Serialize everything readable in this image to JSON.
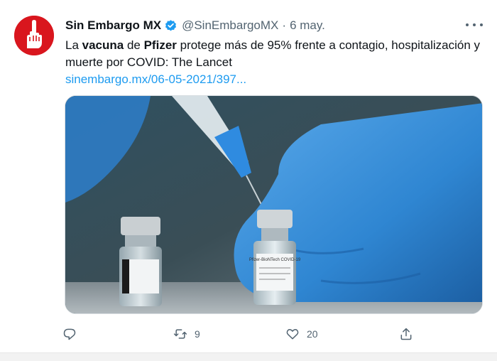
{
  "tweet": {
    "author_name": "Sin Embargo MX",
    "handle": "@SinEmbargoMX",
    "separator": "·",
    "time": "6 may.",
    "text_parts": {
      "p1": "La ",
      "bold1": "vacuna",
      "p2": " de ",
      "bold2": "Pfizer",
      "p3": " protege más de 95% frente a contagio, hospitalización y muerte por COVID: The Lancet"
    },
    "link": "sinembargo.mx/06-05-2021/397..."
  },
  "vial_label": "Pfizer-BioNTech COVID-19",
  "actions": {
    "reply_count": "",
    "retweet_count": "9",
    "like_count": "20"
  },
  "icons": {
    "verified": "verified-badge-icon",
    "more": "more-dots-icon",
    "reply": "reply-icon",
    "retweet": "retweet-icon",
    "like": "heart-icon",
    "share": "share-icon"
  },
  "colors": {
    "brand_red": "#d9161e",
    "link_blue": "#1d9bf0",
    "secondary_text": "#536471"
  }
}
